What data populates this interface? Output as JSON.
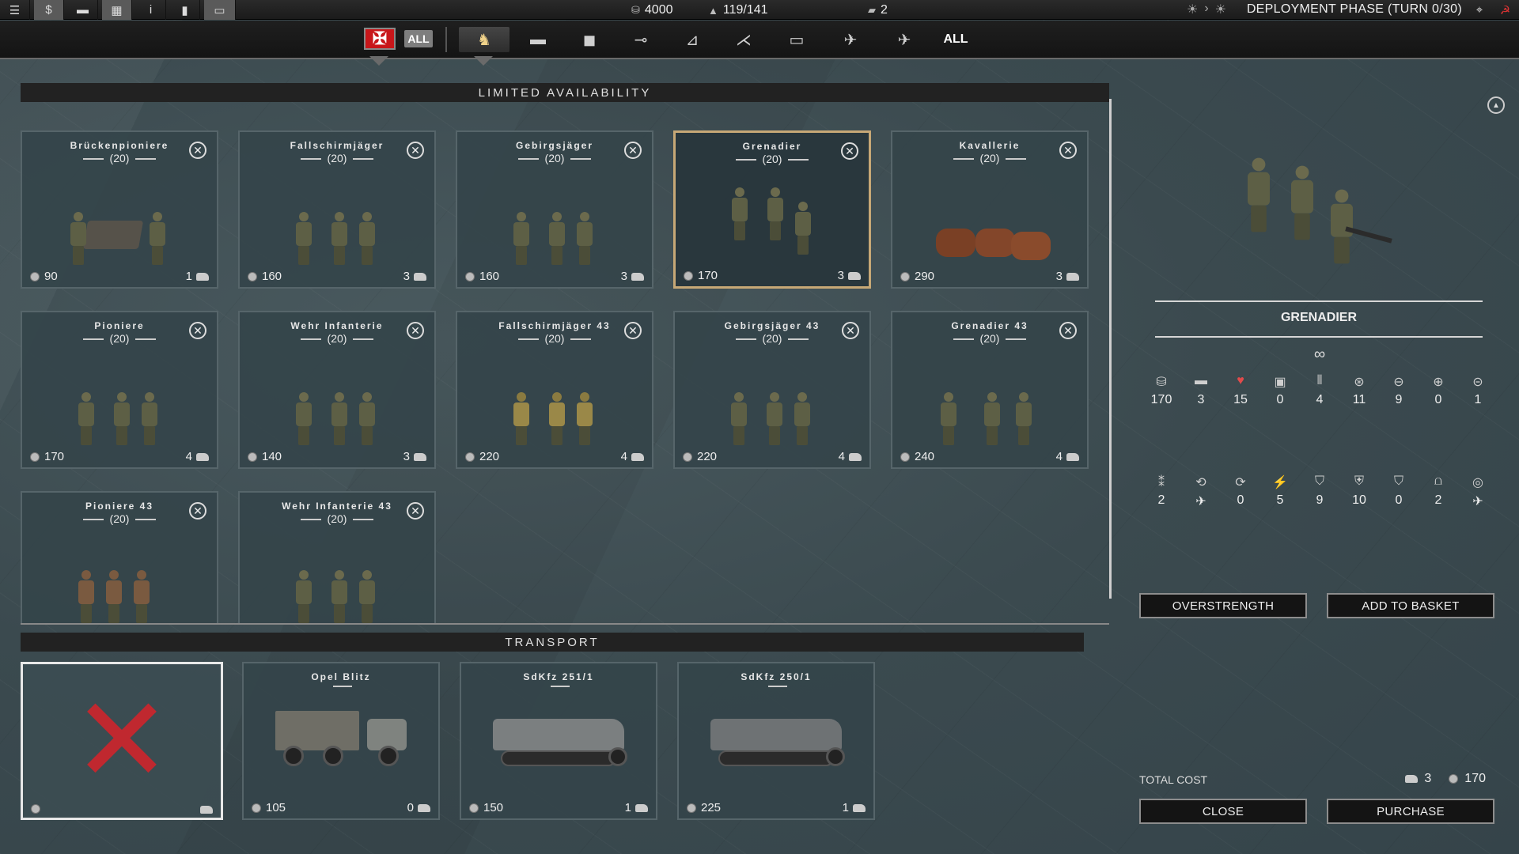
{
  "topbar": {
    "resources": {
      "money": "4000",
      "units": "119/141",
      "vehicles": "2"
    },
    "phase": "DEPLOYMENT PHASE (TURN 0/30)"
  },
  "filters": {
    "flag_all": "ALL",
    "all_label": "ALL",
    "categories": [
      "infantry-icon",
      "tank-icon",
      "armored-car-icon",
      "artillery-icon",
      "anti-tank-icon",
      "anti-air-icon",
      "transport-icon",
      "fighter-icon",
      "bomber-icon"
    ]
  },
  "limited": {
    "header": "LIMITED AVAILABILITY",
    "units": [
      {
        "name": "Brückenpioniere",
        "count": "(20)",
        "cost": "90",
        "slots": "1"
      },
      {
        "name": "Fallschirmjäger",
        "count": "(20)",
        "cost": "160",
        "slots": "3"
      },
      {
        "name": "Gebirgsjäger",
        "count": "(20)",
        "cost": "160",
        "slots": "3"
      },
      {
        "name": "Grenadier",
        "count": "(20)",
        "cost": "170",
        "slots": "3"
      },
      {
        "name": "Kavallerie",
        "count": "(20)",
        "cost": "290",
        "slots": "3"
      },
      {
        "name": "Pioniere",
        "count": "(20)",
        "cost": "170",
        "slots": "4"
      },
      {
        "name": "Wehr Infanterie",
        "count": "(20)",
        "cost": "140",
        "slots": "3"
      },
      {
        "name": "Fallschirmjäger 43",
        "count": "(20)",
        "cost": "220",
        "slots": "4"
      },
      {
        "name": "Gebirgsjäger 43",
        "count": "(20)",
        "cost": "220",
        "slots": "4"
      },
      {
        "name": "Grenadier 43",
        "count": "(20)",
        "cost": "240",
        "slots": "4"
      },
      {
        "name": "Pioniere 43",
        "count": "(20)"
      },
      {
        "name": "Wehr Infanterie 43",
        "count": "(20)"
      }
    ]
  },
  "transport": {
    "header": "TRANSPORT",
    "items": [
      {
        "name": "Opel Blitz",
        "cost": "105",
        "slots": "0"
      },
      {
        "name": "SdKfz 251/1",
        "cost": "150",
        "slots": "1"
      },
      {
        "name": "SdKfz 250/1",
        "cost": "225",
        "slots": "1"
      }
    ]
  },
  "detail": {
    "unit_name": "GRENADIER",
    "infinity": "∞",
    "stats_row1": [
      {
        "icon": "cost-icon",
        "value": "170"
      },
      {
        "icon": "slots-icon",
        "value": "3"
      },
      {
        "icon": "health-icon",
        "value": "15"
      },
      {
        "icon": "fuel-icon",
        "value": "0"
      },
      {
        "icon": "ammo-icon",
        "value": "4"
      },
      {
        "icon": "soft-attack-icon",
        "value": "11"
      },
      {
        "icon": "hard-attack-icon",
        "value": "9"
      },
      {
        "icon": "air-attack-icon",
        "value": "0"
      },
      {
        "icon": "naval-attack-icon",
        "value": "1"
      }
    ],
    "stats_row2": [
      {
        "icon": "movement-icon",
        "value": "2"
      },
      {
        "icon": "range-icon",
        "value": "✈"
      },
      {
        "icon": "initiative-icon",
        "value": "0"
      },
      {
        "icon": "spotting-icon",
        "value": "5"
      },
      {
        "icon": "ground-defense-icon",
        "value": "9"
      },
      {
        "icon": "close-defense-icon",
        "value": "10"
      },
      {
        "icon": "air-defense-icon",
        "value": "0"
      },
      {
        "icon": "entrenchment-icon",
        "value": "2"
      },
      {
        "icon": "target-type-icon",
        "value": "✈"
      }
    ],
    "overstrength_label": "OVERSTRENGTH",
    "add_basket_label": "ADD TO BASKET",
    "total_cost_label": "TOTAL COST",
    "total_slots": "3",
    "total_cost": "170",
    "close_label": "CLOSE",
    "purchase_label": "PURCHASE"
  }
}
